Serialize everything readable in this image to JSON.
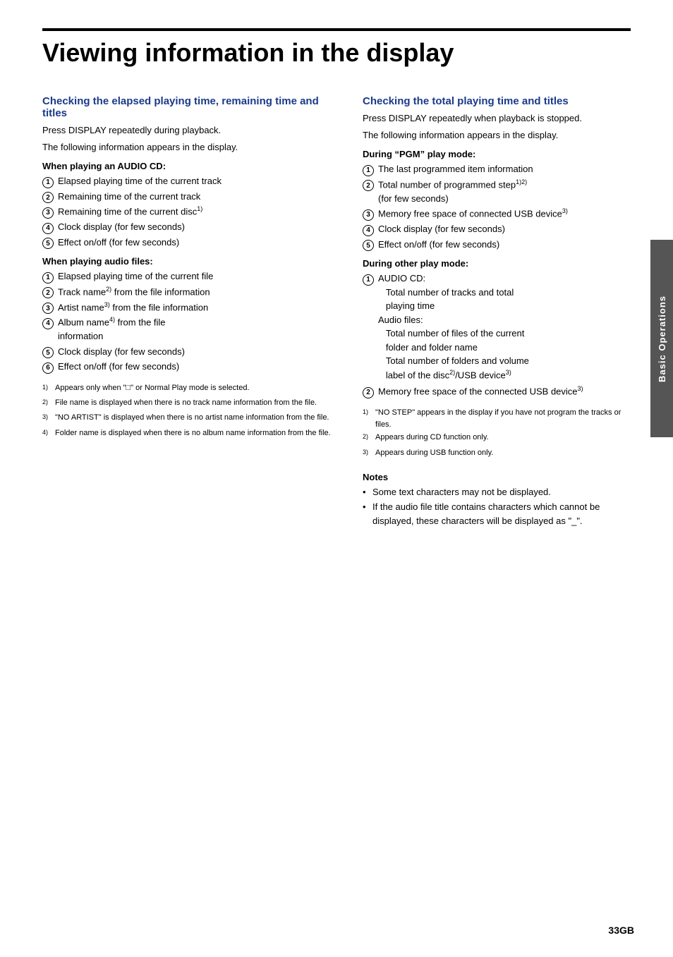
{
  "page": {
    "title": "Viewing information in the display",
    "page_number": "33GB",
    "side_tab": "Basic Operations"
  },
  "left_col": {
    "section1": {
      "heading": "Checking the elapsed playing time, remaining time and titles",
      "intro1": "Press DISPLAY repeatedly during playback.",
      "intro2": "The following information appears in the display.",
      "subsection1": {
        "heading": "When playing an AUDIO CD:",
        "items": [
          "Elapsed playing time of the current track",
          "Remaining time of the current track",
          "Remaining time of the current disc",
          "Clock display (for few seconds)",
          "Effect on/off (for few seconds)"
        ],
        "sup_indices": [
          null,
          null,
          "1)",
          null,
          null
        ]
      },
      "subsection2": {
        "heading": "When playing audio files:",
        "items": [
          "Elapsed playing time of the current file",
          "Track name from the file information",
          "Artist name from the file information",
          "Album name from the file information",
          "Clock display (for few seconds)",
          "Effect on/off (for few seconds)"
        ],
        "sup_indices": [
          null,
          "2)",
          "3)",
          "4)",
          null,
          null
        ]
      }
    },
    "footnotes": [
      {
        "sup": "1)",
        "text": "Appears only when \"□\" or Normal Play mode is selected."
      },
      {
        "sup": "2)",
        "text": "File name is displayed when there is no track name information from the file."
      },
      {
        "sup": "3)",
        "text": "\"NO ARTIST\" is displayed when there is no artist name information from the file."
      },
      {
        "sup": "4)",
        "text": "Folder name is displayed when there is no album name information from the file."
      }
    ]
  },
  "right_col": {
    "section2": {
      "heading": "Checking the total playing time and titles",
      "intro1": "Press DISPLAY repeatedly when playback is stopped.",
      "intro2": "The following information appears in the display.",
      "subsection1": {
        "heading": "During “PGM” play mode:",
        "items": [
          "The last programmed item information",
          "Total number of programmed step (for few seconds)",
          "Memory free space of connected USB device",
          "Clock display (for few seconds)",
          "Effect on/off (for few seconds)"
        ],
        "sup_indices": [
          null,
          "1)2)",
          "3)",
          null,
          null
        ],
        "item2_extra": "(for few seconds)"
      },
      "subsection2": {
        "heading": "During other play mode:",
        "item1_label": "AUDIO CD:",
        "item1_sub": [
          "Total number of tracks and total playing time",
          "Audio files:",
          "Total number of files of the current folder and folder name",
          "Total number of folders and volume label of the disc /USB device"
        ],
        "item1_sub_sup": [
          null,
          null,
          null,
          "2)3)"
        ],
        "item2": "Memory free space of the connected USB device"
      },
      "disc_sup": "2)",
      "usb_sup": "3)"
    },
    "footnotes": [
      {
        "sup": "1)",
        "text": "\"NO STEP\" appears in the display if you have not program the tracks or files."
      },
      {
        "sup": "2)",
        "text": "Appears during CD function only."
      },
      {
        "sup": "3)",
        "text": "Appears during USB function only."
      }
    ],
    "notes": {
      "heading": "Notes",
      "items": [
        "Some text characters may not be displayed.",
        "If the audio file title contains characters which cannot be displayed, these characters will be displayed as “_”."
      ]
    }
  }
}
